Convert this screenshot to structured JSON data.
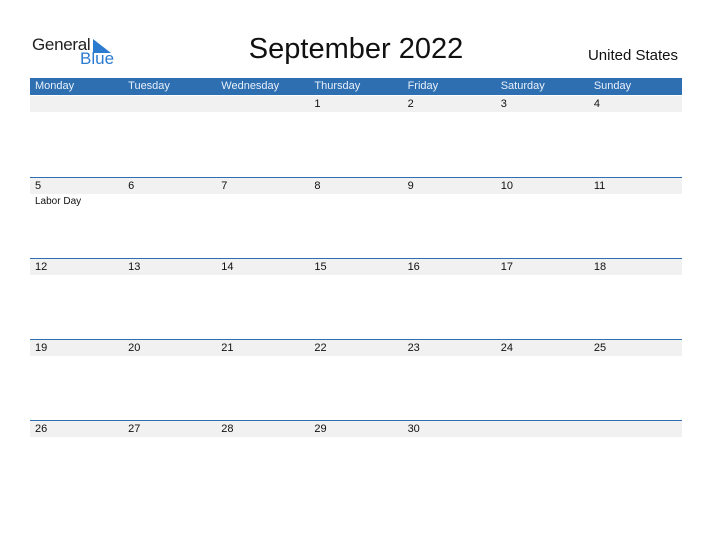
{
  "logo": {
    "general": "General",
    "blue": "Blue"
  },
  "title": "September 2022",
  "country": "United States",
  "colors": {
    "header": "#2e6fb1",
    "date_strip": "#f1f1f1",
    "logo_blue": "#2b7bd0"
  },
  "weekdays": [
    "Monday",
    "Tuesday",
    "Wednesday",
    "Thursday",
    "Friday",
    "Saturday",
    "Sunday"
  ],
  "weeks": [
    {
      "days": [
        "",
        "",
        "",
        "1",
        "2",
        "3",
        "4"
      ],
      "events": [
        "",
        "",
        "",
        "",
        "",
        "",
        ""
      ]
    },
    {
      "days": [
        "5",
        "6",
        "7",
        "8",
        "9",
        "10",
        "11"
      ],
      "events": [
        "Labor Day",
        "",
        "",
        "",
        "",
        "",
        ""
      ]
    },
    {
      "days": [
        "12",
        "13",
        "14",
        "15",
        "16",
        "17",
        "18"
      ],
      "events": [
        "",
        "",
        "",
        "",
        "",
        "",
        ""
      ]
    },
    {
      "days": [
        "19",
        "20",
        "21",
        "22",
        "23",
        "24",
        "25"
      ],
      "events": [
        "",
        "",
        "",
        "",
        "",
        "",
        ""
      ]
    },
    {
      "days": [
        "26",
        "27",
        "28",
        "29",
        "30",
        "",
        ""
      ],
      "events": [
        "",
        "",
        "",
        "",
        "",
        "",
        ""
      ]
    }
  ]
}
